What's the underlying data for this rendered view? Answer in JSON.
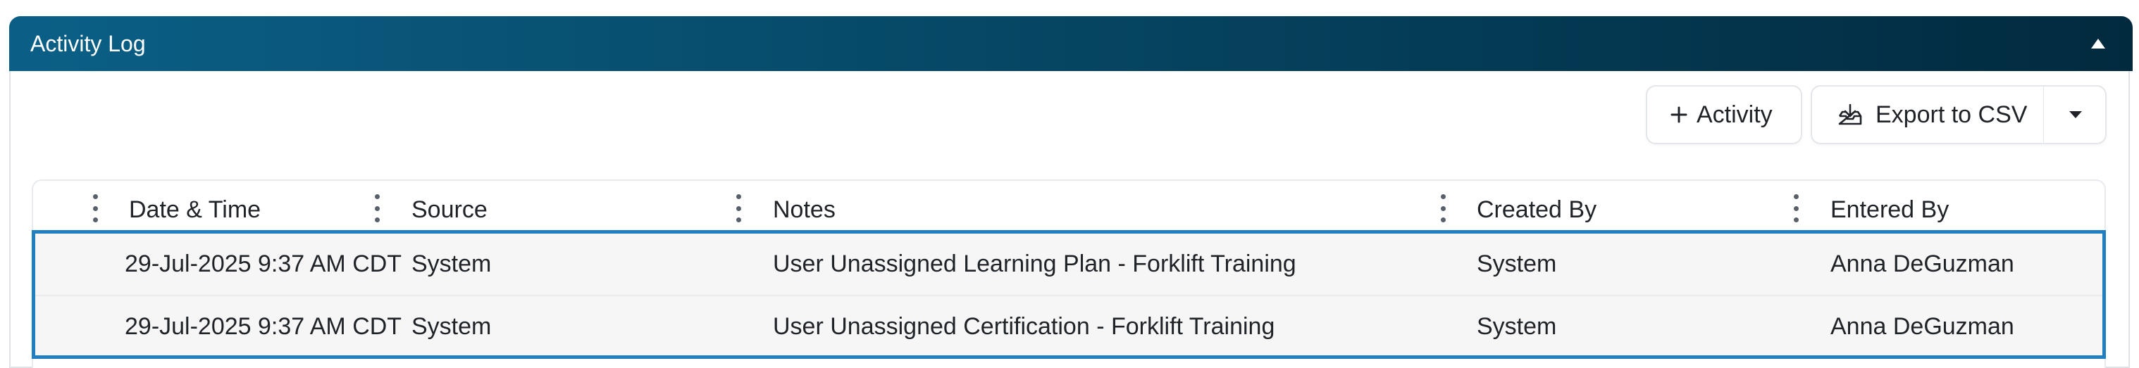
{
  "panel": {
    "title": "Activity Log"
  },
  "toolbar": {
    "add_activity_label": "Activity",
    "export_label": "Export to CSV"
  },
  "table": {
    "columns": {
      "date_time": "Date & Time",
      "source": "Source",
      "notes": "Notes",
      "created_by": "Created By",
      "entered_by": "Entered By"
    },
    "rows": [
      {
        "date_time": "29-Jul-2025 9:37 AM CDT",
        "source": "System",
        "notes": "User Unassigned Learning Plan - Forklift Training",
        "created_by": "System",
        "entered_by": "Anna DeGuzman"
      },
      {
        "date_time": "29-Jul-2025 9:37 AM CDT",
        "source": "System",
        "notes": "User Unassigned Certification - Forklift Training",
        "created_by": "System",
        "entered_by": "Anna DeGuzman"
      }
    ]
  },
  "colors": {
    "header_gradient_start": "#0b5f86",
    "header_gradient_end": "#022a3f",
    "selection_border": "#1f7fc0",
    "row_background": "#f6f6f7"
  },
  "icons": {
    "collapse": "caret-up-icon",
    "add": "plus-icon",
    "export": "download-tray-icon",
    "dropdown": "caret-down-icon",
    "column_menu": "vertical-dots-icon"
  }
}
